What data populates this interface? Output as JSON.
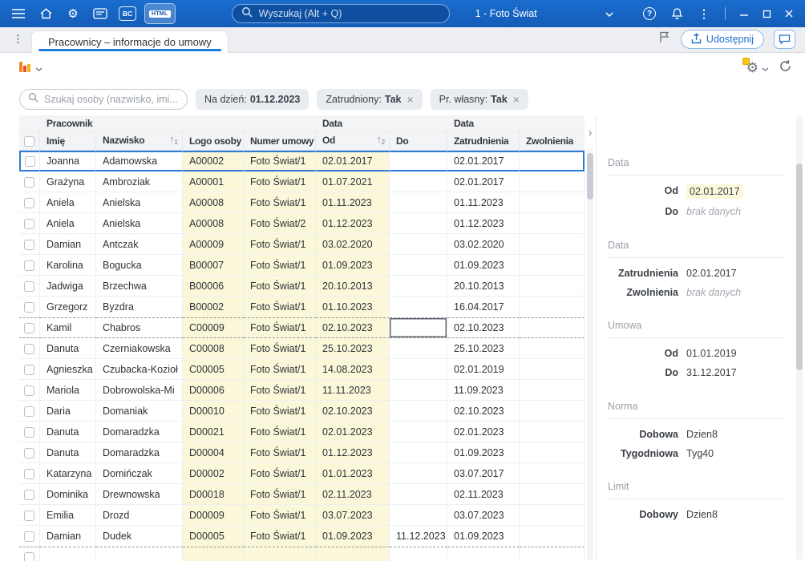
{
  "icons": {
    "kebab": "⋮",
    "sort_arrow": "↑",
    "panel_toggle": "›",
    "help_glyph": "?",
    "close": "×",
    "gear": "⚙"
  },
  "topbar": {
    "bc_label": "BC",
    "html_label": "HTML",
    "search_placeholder": "Wyszukaj (Alt + Q)",
    "company": "1 - Foto Świat"
  },
  "tabbar": {
    "tab_label": "Pracownicy – informacje do umowy",
    "share_label": "Udostępnij"
  },
  "filters": {
    "search_placeholder": "Szukaj osoby (nazwisko, imi...",
    "date_chip": {
      "label": "Na dzień:",
      "value": "01.12.2023"
    },
    "chips": [
      {
        "label": "Zatrudniony:",
        "value": "Tak"
      },
      {
        "label": "Pr. własny:",
        "value": "Tak"
      }
    ]
  },
  "table": {
    "groups": [
      {
        "label": "Pracownik"
      },
      {
        "label": "Data"
      },
      {
        "label": "Data"
      }
    ],
    "columns": [
      "Imię",
      "Nazwisko",
      "Logo osoby",
      "Numer umowy",
      "Od",
      "Do",
      "Zatrudnienia",
      "Zwolnienia"
    ],
    "sort": {
      "nazwisko": "1",
      "od": "2"
    },
    "rows": [
      {
        "imie": "Joanna",
        "nazwisko": "Adamowska",
        "logo": "A00002",
        "numer": "Foto Świat/1",
        "od": "02.01.2017",
        "do": "",
        "zatrudnienia": "02.01.2017",
        "zwolnienia": "",
        "selected": true
      },
      {
        "imie": "Grażyna",
        "nazwisko": "Ambroziak",
        "logo": "A00001",
        "numer": "Foto Świat/1",
        "od": "01.07.2021",
        "do": "",
        "zatrudnienia": "02.01.2017",
        "zwolnienia": ""
      },
      {
        "imie": "Aniela",
        "nazwisko": "Anielska",
        "logo": "A00008",
        "numer": "Foto Świat/1",
        "od": "01.11.2023",
        "do": "",
        "zatrudnienia": "01.11.2023",
        "zwolnienia": ""
      },
      {
        "imie": "Aniela",
        "nazwisko": "Anielska",
        "logo": "A00008",
        "numer": "Foto Świat/2",
        "od": "01.12.2023",
        "do": "",
        "zatrudnienia": "01.12.2023",
        "zwolnienia": ""
      },
      {
        "imie": "Damian",
        "nazwisko": "Antczak",
        "logo": "A00009",
        "numer": "Foto Świat/1",
        "od": "03.02.2020",
        "do": "",
        "zatrudnienia": "03.02.2020",
        "zwolnienia": ""
      },
      {
        "imie": "Karolina",
        "nazwisko": "Bogucka",
        "logo": "B00007",
        "numer": "Foto Świat/1",
        "od": "01.09.2023",
        "do": "",
        "zatrudnienia": "01.09.2023",
        "zwolnienia": ""
      },
      {
        "imie": "Jadwiga",
        "nazwisko": "Brzechwa",
        "logo": "B00006",
        "numer": "Foto Świat/1",
        "od": "20.10.2013",
        "do": "",
        "zatrudnienia": "20.10.2013",
        "zwolnienia": ""
      },
      {
        "imie": "Grzegorz",
        "nazwisko": "Byzdra",
        "logo": "B00002",
        "numer": "Foto Świat/1",
        "od": "01.10.2023",
        "do": "",
        "zatrudnienia": "16.04.2017",
        "zwolnienia": ""
      },
      {
        "imie": "Kamil",
        "nazwisko": "Chabros",
        "logo": "C00009",
        "numer": "Foto Świat/1",
        "od": "02.10.2023",
        "do": "",
        "zatrudnienia": "02.10.2023",
        "zwolnienia": "",
        "dashed": true,
        "focus_cell": "do"
      },
      {
        "imie": "Danuta",
        "nazwisko": "Czerniakowska",
        "logo": "C00008",
        "numer": "Foto Świat/1",
        "od": "25.10.2023",
        "do": "",
        "zatrudnienia": "25.10.2023",
        "zwolnienia": ""
      },
      {
        "imie": "Agnieszka",
        "nazwisko": "Czubacka-Kozioł",
        "logo": "C00005",
        "numer": "Foto Świat/1",
        "od": "14.08.2023",
        "do": "",
        "zatrudnienia": "02.01.2019",
        "zwolnienia": ""
      },
      {
        "imie": "Mariola",
        "nazwisko": "Dobrowolska-Mi",
        "logo": "D00006",
        "numer": "Foto Świat/1",
        "od": "11.11.2023",
        "do": "",
        "zatrudnienia": "11.09.2023",
        "zwolnienia": ""
      },
      {
        "imie": "Daria",
        "nazwisko": "Domaniak",
        "logo": "D00010",
        "numer": "Foto Świat/1",
        "od": "02.10.2023",
        "do": "",
        "zatrudnienia": "02.10.2023",
        "zwolnienia": ""
      },
      {
        "imie": "Danuta",
        "nazwisko": "Domaradzka",
        "logo": "D00021",
        "numer": "Foto Świat/1",
        "od": "02.01.2023",
        "do": "",
        "zatrudnienia": "02.01.2023",
        "zwolnienia": ""
      },
      {
        "imie": "Danuta",
        "nazwisko": "Domaradzka",
        "logo": "D00004",
        "numer": "Foto Świat/1",
        "od": "01.12.2023",
        "do": "",
        "zatrudnienia": "01.09.2023",
        "zwolnienia": ""
      },
      {
        "imie": "Katarzyna",
        "nazwisko": "Domińczak",
        "logo": "D00002",
        "numer": "Foto Świat/1",
        "od": "01.01.2023",
        "do": "",
        "zatrudnienia": "03.07.2017",
        "zwolnienia": ""
      },
      {
        "imie": "Dominika",
        "nazwisko": "Drewnowska",
        "logo": "D00018",
        "numer": "Foto Świat/1",
        "od": "02.11.2023",
        "do": "",
        "zatrudnienia": "02.11.2023",
        "zwolnienia": ""
      },
      {
        "imie": "Emilia",
        "nazwisko": "Drozd",
        "logo": "D00009",
        "numer": "Foto Świat/1",
        "od": "03.07.2023",
        "do": "",
        "zatrudnienia": "03.07.2023",
        "zwolnienia": ""
      },
      {
        "imie": "Damian",
        "nazwisko": "Dudek",
        "logo": "D00005",
        "numer": "Foto Świat/1",
        "od": "01.09.2023",
        "do": "11.12.2023",
        "zatrudnienia": "01.09.2023",
        "zwolnienia": ""
      },
      {
        "imie": "",
        "nazwisko": "",
        "logo": "",
        "numer": "",
        "od": "",
        "do": "",
        "zatrudnienia": "",
        "zwolnienia": "",
        "partial": true
      }
    ]
  },
  "details": {
    "sections": [
      {
        "title": "Data",
        "fields": [
          {
            "label": "Od",
            "value": "02.01.2017",
            "highlight": true
          },
          {
            "label": "Do",
            "value": "brak danych",
            "empty": true
          }
        ]
      },
      {
        "title": "Data",
        "fields": [
          {
            "label": "Zatrudnienia",
            "value": "02.01.2017"
          },
          {
            "label": "Zwolnienia",
            "value": "brak danych",
            "empty": true
          }
        ]
      },
      {
        "title": "Umowa",
        "fields": [
          {
            "label": "Od",
            "value": "01.01.2019"
          },
          {
            "label": "Do",
            "value": "31.12.2017"
          }
        ]
      },
      {
        "title": "Norma",
        "fields": [
          {
            "label": "Dobowa",
            "value": "Dzien8"
          },
          {
            "label": "Tygodniowa",
            "value": "Tyg40"
          }
        ]
      },
      {
        "title": "Limit",
        "fields": [
          {
            "label": "Dobowy",
            "value": "Dzien8"
          }
        ]
      }
    ]
  }
}
